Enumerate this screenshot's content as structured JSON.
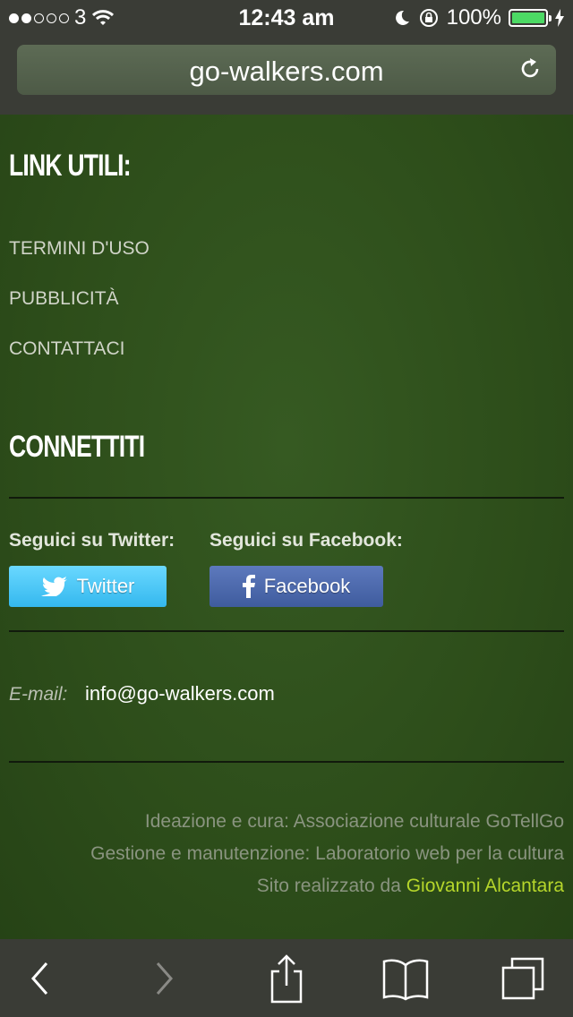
{
  "status": {
    "carrier": "3",
    "time": "12:43 am",
    "battery": "100%",
    "signal_bars_filled": 2,
    "signal_bars_total": 5,
    "battery_level": 1.0
  },
  "browser": {
    "url": "go-walkers.com"
  },
  "links_section": {
    "heading": "LINK UTILI:",
    "items": [
      "TERMINI D'USO",
      "PUBBLICITÀ",
      "CONTATTACI"
    ]
  },
  "connect_section": {
    "heading": "CONNETTITI",
    "twitter_label": "Seguici su Twitter:",
    "facebook_label": "Seguici su Facebook:",
    "twitter_button": "Twitter",
    "facebook_button": "Facebook",
    "email_label": "E-mail:",
    "email": "info@go-walkers.com"
  },
  "credits": {
    "line1": "Ideazione e cura: Associazione culturale GoTellGo",
    "line2": "Gestione e manutenzione: Laboratorio web per la cultura",
    "line3_prefix": "Sito realizzato da",
    "line3_name": "Giovanni Alcantara"
  },
  "colors": {
    "page_bg": "#2c4a1a",
    "twitter_blue": "#34b8ee",
    "facebook_blue": "#3f5c9e",
    "accent_link": "#b6d62b"
  },
  "icons": {
    "back": "chevron-left-icon",
    "forward": "chevron-right-icon",
    "share": "share-icon",
    "bookmarks": "book-icon",
    "tabs": "tabs-icon"
  }
}
